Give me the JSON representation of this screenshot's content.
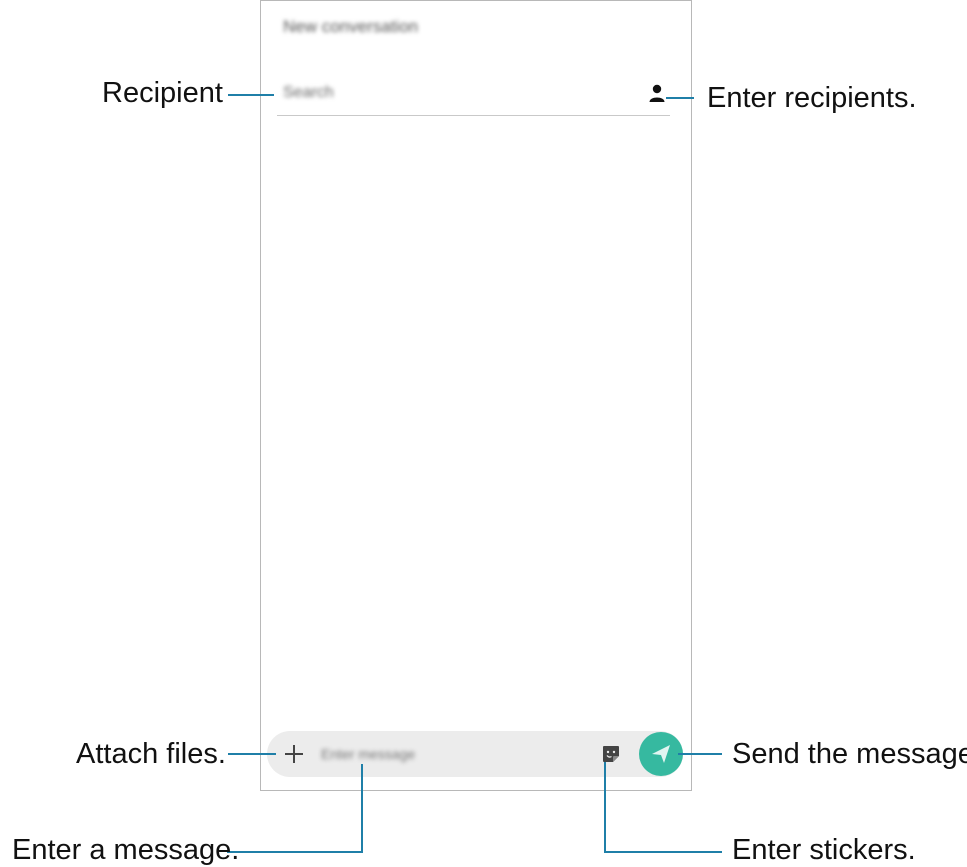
{
  "screen": {
    "header_title": "New conversation",
    "recipient_placeholder": "Search",
    "message_placeholder": "Enter message",
    "accent_color": "#36b9a0"
  },
  "icons": {
    "contact": "person-icon",
    "attach": "plus-icon",
    "sticker": "sticker-icon",
    "send": "send-arrow-icon"
  },
  "callouts": {
    "recipient": "Recipient",
    "enter_recipients": "Enter recipients.",
    "attach_files": "Attach files.",
    "send_message": "Send the message.",
    "enter_message": "Enter a message.",
    "enter_stickers": "Enter stickers."
  },
  "callout_line_color": "#1f7fa8"
}
